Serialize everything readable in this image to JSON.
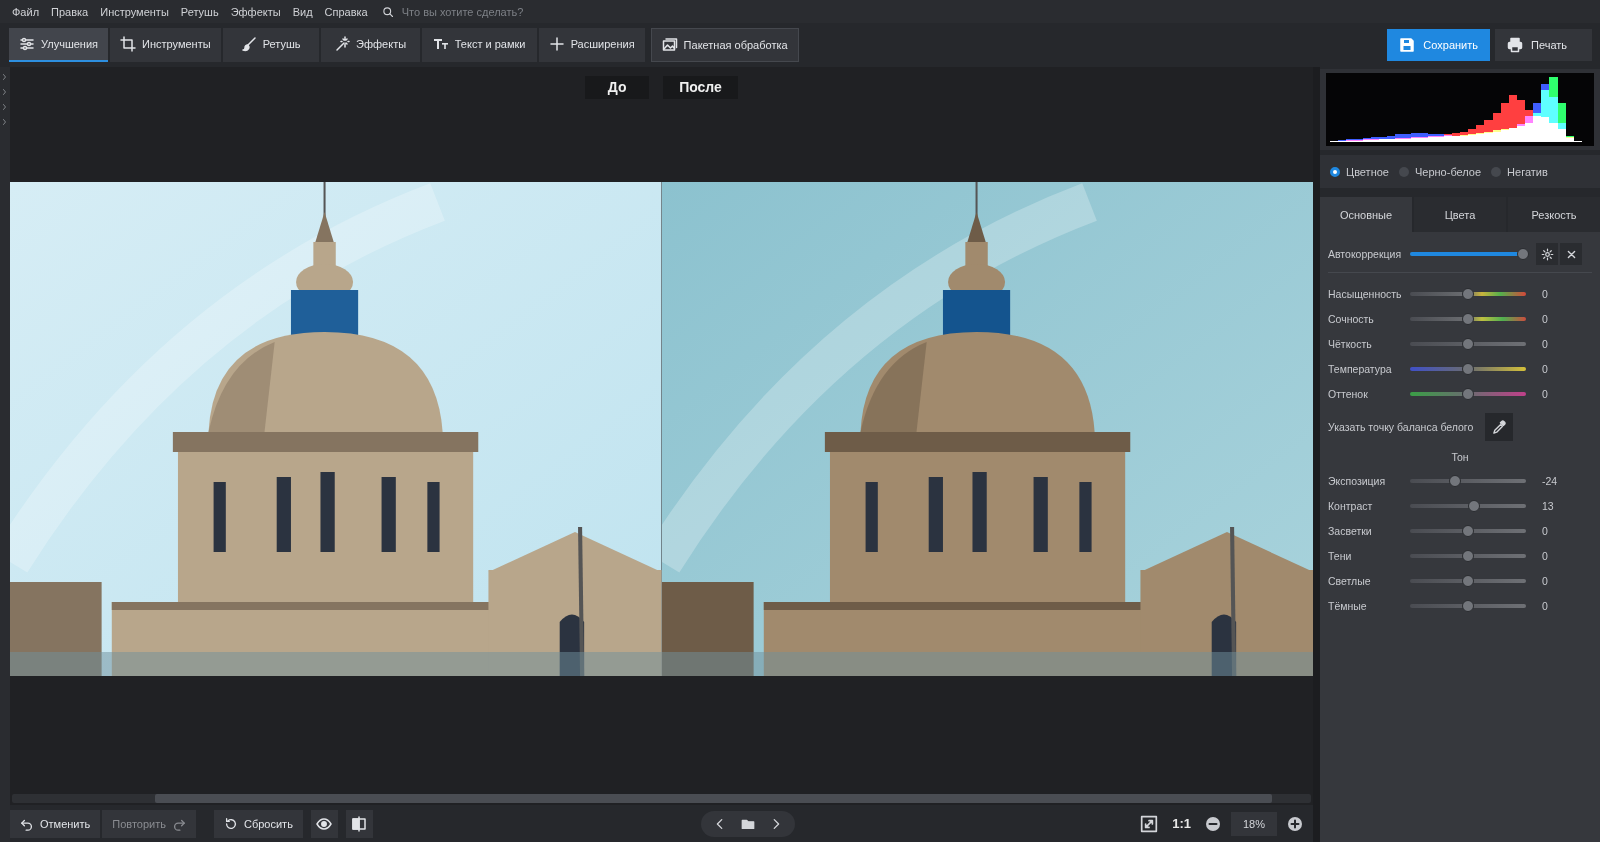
{
  "menu": [
    "Файл",
    "Правка",
    "Инструменты",
    "Ретушь",
    "Эффекты",
    "Вид",
    "Справка"
  ],
  "search": {
    "placeholder": "Что вы хотите сделать?"
  },
  "toolbar_tabs": [
    {
      "label": "Улучшения",
      "selected": true
    },
    {
      "label": "Инструменты",
      "selected": false
    },
    {
      "label": "Ретушь",
      "selected": false
    },
    {
      "label": "Эффекты",
      "selected": false
    },
    {
      "label": "Текст и рамки",
      "selected": false
    },
    {
      "label": "Расширения",
      "selected": false
    },
    {
      "label": "Пакетная обработка",
      "selected": false
    }
  ],
  "actions": {
    "save": "Сохранить",
    "print": "Печать"
  },
  "compare": {
    "before": "До",
    "after": "После"
  },
  "canvas_scrollbar": {
    "offset": 0.11,
    "level": 0.86
  },
  "histogram": {
    "red": [
      2,
      2,
      3,
      3,
      4,
      4,
      5,
      5,
      6,
      6,
      7,
      8,
      9,
      10,
      12,
      14,
      16,
      20,
      26,
      34,
      45,
      60,
      72,
      65,
      50,
      40,
      38,
      30,
      20,
      8,
      2,
      0
    ],
    "green": [
      1,
      1,
      2,
      2,
      3,
      3,
      4,
      4,
      5,
      5,
      6,
      6,
      7,
      8,
      9,
      10,
      11,
      12,
      14,
      16,
      18,
      20,
      22,
      24,
      30,
      45,
      80,
      100,
      60,
      10,
      2,
      0
    ],
    "blue": [
      2,
      3,
      4,
      5,
      6,
      7,
      8,
      10,
      12,
      13,
      14,
      14,
      13,
      12,
      11,
      10,
      10,
      11,
      12,
      14,
      16,
      18,
      22,
      28,
      40,
      60,
      90,
      70,
      30,
      6,
      1,
      0
    ]
  },
  "color_modes": [
    {
      "label": "Цветное",
      "selected": true
    },
    {
      "label": "Черно-белое",
      "selected": false
    },
    {
      "label": "Негатив",
      "selected": false
    }
  ],
  "panel_tabs": [
    {
      "label": "Основные",
      "selected": true
    },
    {
      "label": "Цвета",
      "selected": false
    },
    {
      "label": "Резкость",
      "selected": false
    }
  ],
  "autocorrection": {
    "label": "Автокоррекция",
    "level": 0.97
  },
  "adjustments": [
    {
      "label": "Насыщенность",
      "value": "0",
      "level": 0.5,
      "kind": "saturation"
    },
    {
      "label": "Сочность",
      "value": "0",
      "level": 0.5,
      "kind": "vibrance"
    },
    {
      "label": "Чёткость",
      "value": "0",
      "level": 0.5,
      "kind": "plain"
    },
    {
      "label": "Температура",
      "value": "0",
      "level": 0.5,
      "kind": "temperature"
    },
    {
      "label": "Оттенок",
      "value": "0",
      "level": 0.5,
      "kind": "tint"
    }
  ],
  "white_balance": {
    "label": "Указать точку баланса белого"
  },
  "tone": {
    "title": "Тон",
    "sliders": [
      {
        "label": "Экспозиция",
        "value": "-24",
        "level": 0.39,
        "kind": "plain"
      },
      {
        "label": "Контраст",
        "value": "13",
        "level": 0.55,
        "kind": "plain"
      },
      {
        "label": "Засветки",
        "value": "0",
        "level": 0.5,
        "kind": "plain"
      },
      {
        "label": "Тени",
        "value": "0",
        "level": 0.5,
        "kind": "plain"
      },
      {
        "label": "Светлые",
        "value": "0",
        "level": 0.5,
        "kind": "plain"
      },
      {
        "label": "Тёмные",
        "value": "0",
        "level": 0.5,
        "kind": "plain"
      }
    ]
  },
  "bottom_bar": {
    "undo": "Отменить",
    "redo": {
      "label": "Повторить",
      "disabled": true
    },
    "reset": "Сбросить",
    "zoom_fit": "1:1",
    "zoom": "18%"
  }
}
